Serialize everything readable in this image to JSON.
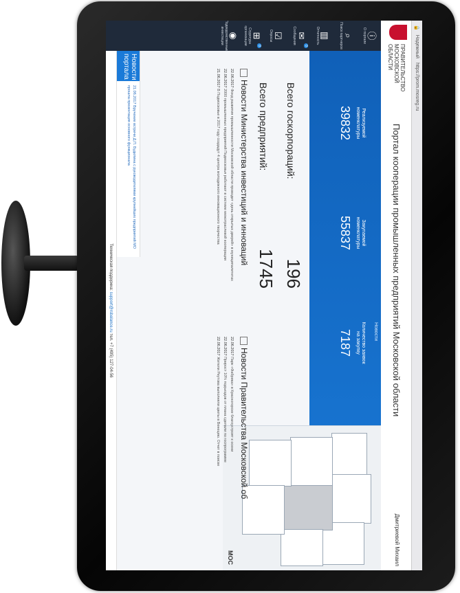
{
  "browser": {
    "url_label": "Надежный",
    "url": "https://prom.mosreg.ru"
  },
  "header": {
    "gov_line1": "ПРАВИТЕЛЬСТВО",
    "gov_line2": "МОСКОВСКОЙ ОБЛАСТИ",
    "title": "Портал кооперации промышленных предприятий Московской области",
    "user": "Дмитриевой Михаил"
  },
  "sidebar": {
    "items": [
      {
        "label": "О портале",
        "icon": "i"
      },
      {
        "label": "Поиск партнеров",
        "icon": "⌕"
      },
      {
        "label": "Отчетность",
        "icon": "▥"
      },
      {
        "label": "Сообщения",
        "icon": "✉",
        "badge": "0"
      },
      {
        "label": "Опросы",
        "icon": "☑"
      },
      {
        "label": "Структура организации",
        "icon": "⊞",
        "badge": "0"
      },
      {
        "label": "Подведомственные инвестиции",
        "icon": "◉"
      }
    ]
  },
  "banner": {
    "news_tab": "Новости",
    "stats": [
      {
        "label_1": "Реализуемой",
        "label_2": "номенклатуры",
        "value": "39832"
      },
      {
        "label_1": "Закупаемой",
        "label_2": "номенклатуры",
        "value": "55837"
      },
      {
        "label_1": "Количество заявок",
        "label_2": "на закупку",
        "value": "7187"
      }
    ]
  },
  "totals": {
    "corp_label": "Всего госкорпораций:",
    "corp_value": "196",
    "ent_label": "Всего предприятий:",
    "ent_value": "1745"
  },
  "news_ministry": {
    "title": "Новости Министерства инвестиций и инноваций",
    "items": [
      {
        "date": "22.06.2017",
        "text": "Фонд развития промышленности Московской области проводит «день открытых дверей» в муниципалитетах"
      },
      {
        "date": "22.06.2017",
        "text": "2000 промышленных предприятий Подмосковья работают в системе межотраслевой кооперации"
      },
      {
        "date": "21.06.2017",
        "text": "В Подмосковье в 2017 году создадут 4 центра молодежного инновационного творчества"
      }
    ]
  },
  "news_gov": {
    "title": "Новости Правительства Московской об",
    "items": [
      {
        "date": "22.06.2017",
        "text": "Парк «Фабрика» в Красногорске благоустроят к осени"
      },
      {
        "date": "22.06.2017",
        "text": "Прирост 10% подъездов от плана сделали по госпрограмме"
      },
      {
        "date": "22.06.2017",
        "text": "Жители Реутова выполняли цветы в Венецию. Отчет в поиске"
      }
    ]
  },
  "portal_news": {
    "badge_1": "Новости",
    "badge_2": "портала",
    "text": "21.06.2017 Вручение встречи Д.П. Будилина с руководителями крупнейших предприятий МО прошла презентация основного функционала"
  },
  "footer": {
    "prefix": "Техническая поддержка:",
    "email": "support@rsbalance.ru",
    "phone": "тел. +7 (495) 127-04-56"
  },
  "map": {
    "label": "МОС"
  }
}
